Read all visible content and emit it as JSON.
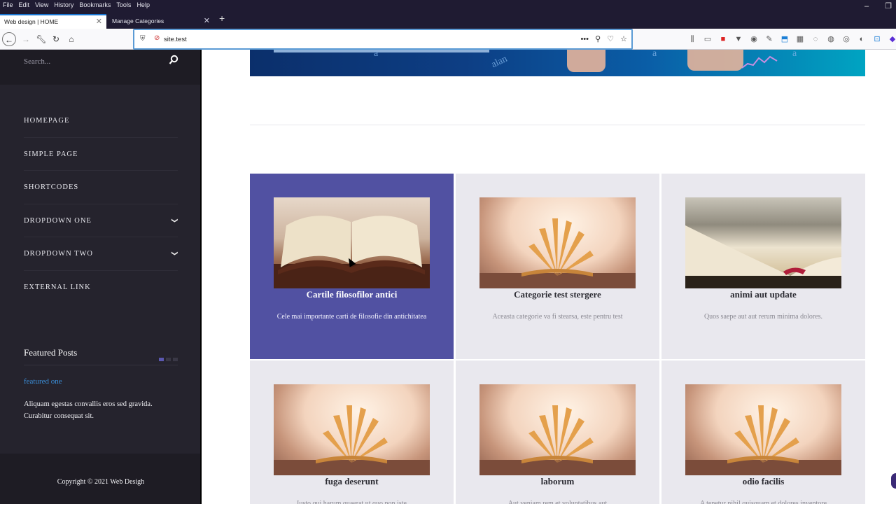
{
  "browser": {
    "menu": [
      "File",
      "Edit",
      "View",
      "History",
      "Bookmarks",
      "Tools",
      "Help"
    ],
    "tabs": [
      {
        "label": "Web design | HOME",
        "active": true
      },
      {
        "label": "Manage Categories",
        "active": false
      }
    ],
    "url": "site.test",
    "window_controls": [
      "–",
      "❐"
    ]
  },
  "sidebar": {
    "search_placeholder": "Search...",
    "nav": [
      {
        "label": "HOMEPAGE",
        "has_dropdown": false
      },
      {
        "label": "SIMPLE PAGE",
        "has_dropdown": false
      },
      {
        "label": "SHORTCODES",
        "has_dropdown": false
      },
      {
        "label": "DROPDOWN ONE",
        "has_dropdown": true
      },
      {
        "label": "DROPDOWN TWO",
        "has_dropdown": true
      },
      {
        "label": "EXTERNAL LINK",
        "has_dropdown": false
      }
    ],
    "featured": {
      "title": "Featured Posts",
      "post_link": "featured one",
      "post_excerpt": "Aliquam egestas convallis eros sed gravida. Curabitur consequat sit."
    },
    "copyright": "Copyright © 2021 Web Desigh"
  },
  "main": {
    "categories": [
      {
        "title": "Cartile filosofilor antici",
        "desc": "Cele mai importante carti de filosofie din antichitatea",
        "image": "old-book",
        "active": true
      },
      {
        "title": "Categorie test stergere",
        "desc": "Aceasta categorie va fi stearsa, este pentru test",
        "image": "fanned-book",
        "active": false
      },
      {
        "title": "animi aut update",
        "desc": "Quos saepe aut aut rerum minima dolores.",
        "image": "open-book",
        "active": false
      },
      {
        "title": "fuga deserunt",
        "desc": "Iusto qui harum quaerat ut quo non iste",
        "image": "fanned-book",
        "active": false
      },
      {
        "title": "laborum",
        "desc": "Aut veniam rem et voluptatibus aut",
        "image": "fanned-book",
        "active": false
      },
      {
        "title": "odio facilis",
        "desc": "A tenetur nihil quisquam et dolores inventore",
        "image": "fanned-book",
        "active": false
      }
    ]
  },
  "colors": {
    "sidebar_bg": "#25232d",
    "accent": "#5151a2",
    "card_bg": "#e9e8ee",
    "link": "#3b8ed8"
  }
}
